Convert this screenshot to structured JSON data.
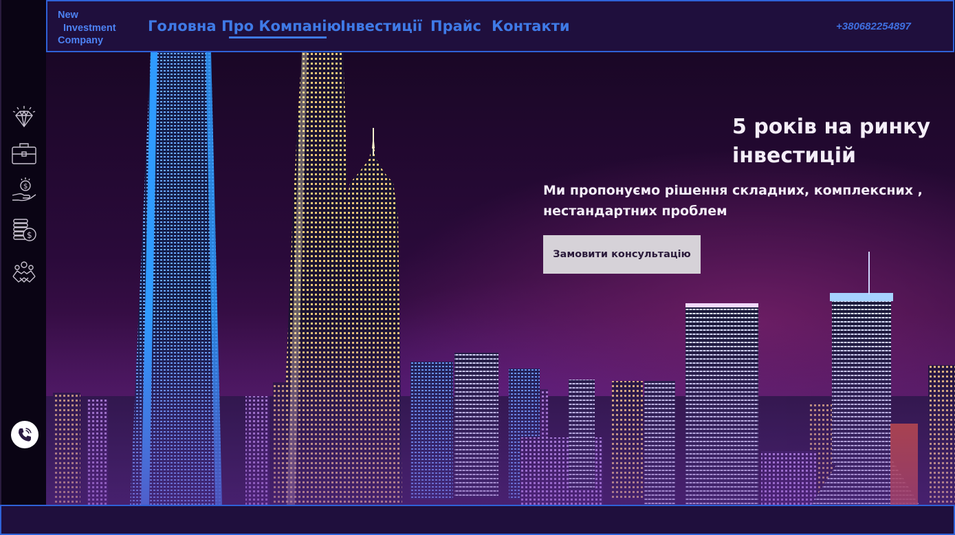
{
  "brand": {
    "line1": "New",
    "line2": "Investment",
    "line3": "Company"
  },
  "nav": {
    "items": [
      {
        "label": "Головна"
      },
      {
        "label": "Про Компанію",
        "active": true
      },
      {
        "label": "Інвестиції"
      },
      {
        "label": "Прайс"
      },
      {
        "label": "Контакти"
      }
    ],
    "phone": "+380682254897"
  },
  "sidebar": {
    "icons": [
      "diamond-icon",
      "briefcase-icon",
      "money-hand-icon",
      "coin-stack-icon",
      "handshake-people-icon"
    ],
    "fab_icon": "phone-call-icon"
  },
  "hero": {
    "title": "5 років на ринку інвестицій",
    "subtitle": "Ми пропонуємо рішення складних, комплексних , нестандартних проблем",
    "cta_label": "Замовити консультацію"
  },
  "colors": {
    "accent": "#3f7ae6",
    "nav_bg": "#1f0f3d",
    "border": "#2f62d8",
    "cta_bg": "#d6d2d8"
  }
}
